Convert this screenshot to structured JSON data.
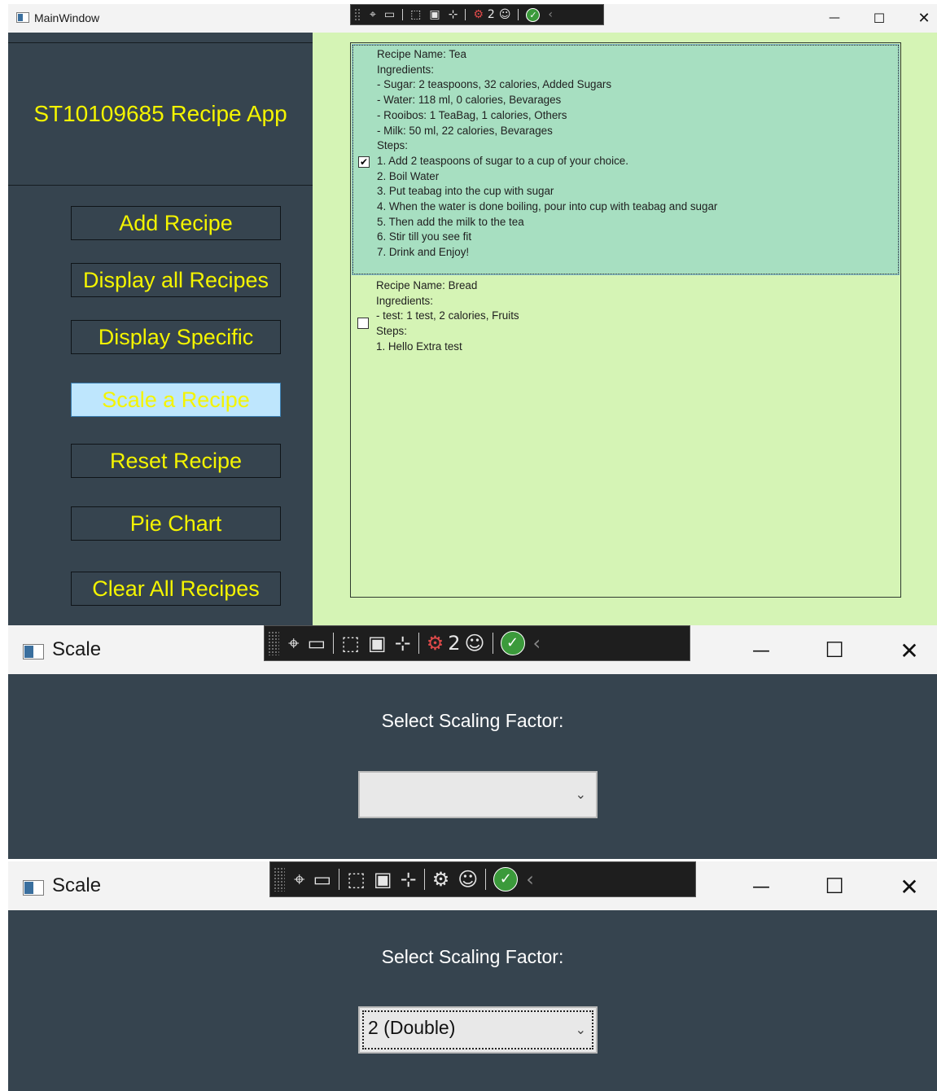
{
  "main_window": {
    "title": "MainWindow",
    "app_title": "ST10109685 Recipe App",
    "nav": [
      {
        "label": "Add Recipe",
        "active": false
      },
      {
        "label": "Display all Recipes",
        "active": false
      },
      {
        "label": "Display Specific",
        "active": false
      },
      {
        "label": "Scale a Recipe",
        "active": true
      },
      {
        "label": "Reset Recipe",
        "active": false
      },
      {
        "label": "Pie Chart",
        "active": false
      },
      {
        "label": "Clear All Recipes",
        "active": false
      }
    ],
    "recipes": [
      {
        "checked": true,
        "selected": true,
        "lines": [
          "Recipe Name: Tea",
          "Ingredients:",
          "- Sugar: 2 teaspoons, 32 calories, Added Sugars",
          "- Water: 118 ml, 0 calories, Bevarages",
          "- Rooibos: 1 TeaBag, 1 calories, Others",
          "- Milk: 50 ml, 22 calories, Bevarages",
          "Steps:",
          "1. Add 2 teaspoons of sugar to a cup of your choice.",
          "2. Boil Water",
          "3. Put teabag into the cup with sugar",
          "4. When the water is done boiling, pour into cup with teabag and sugar",
          "5. Then add the milk to the tea",
          "6. Stir till you see fit",
          "7. Drink and Enjoy!"
        ]
      },
      {
        "checked": false,
        "selected": false,
        "lines": [
          "Recipe Name: Bread",
          "Ingredients:",
          "- test: 1 test, 2 calories, Fruits",
          "Steps:",
          "1. Hello Extra test"
        ]
      }
    ],
    "devbar_badge": "2"
  },
  "scale_window_1": {
    "title": "Scale",
    "label": "Select Scaling Factor:",
    "combo_value": "",
    "devbar_badge": "2"
  },
  "scale_window_2": {
    "title": "Scale",
    "label": "Select Scaling Factor:",
    "combo_value": "2 (Double)"
  },
  "icons": {
    "minimize": "minimize-icon",
    "maximize": "maximize-icon",
    "close": "close-icon",
    "chevron": "chevron-down-icon"
  },
  "colors": {
    "sidebar_bg": "#36444f",
    "accent_text": "#f4f400",
    "content_bg": "#d5f4b5",
    "selected_item_bg": "#a7dfc1",
    "active_button_bg": "#bee6fd"
  }
}
